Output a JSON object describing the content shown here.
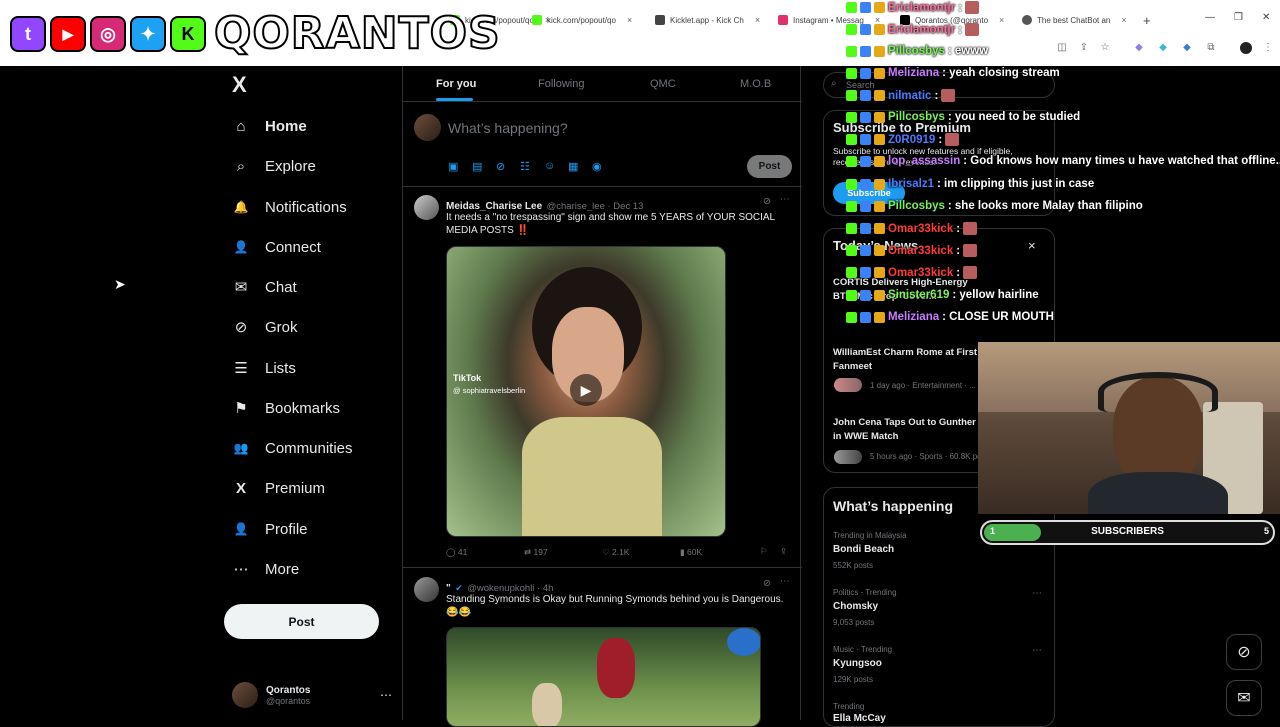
{
  "browser": {
    "tabs": [
      {
        "label": "kick.com/popout/qo",
        "color": "#53fc18"
      },
      {
        "label": "Kicklet.app - Kick Ch",
        "color": "#2a2a2a"
      },
      {
        "label": "Instagram • Messag",
        "color": "#e1306c"
      },
      {
        "label": "Qorantos (@qoranto",
        "color": "#000000"
      },
      {
        "label": "The best ChatBot an",
        "color": "#444444"
      }
    ],
    "new_tab": "+",
    "tab_close": "×"
  },
  "overlay": {
    "brand": "QORANTOS",
    "logos": [
      {
        "name": "twitch",
        "glyph": "t",
        "color": "#9146ff"
      },
      {
        "name": "youtube",
        "glyph": "▶",
        "color": "#ff0000"
      },
      {
        "name": "instagram",
        "glyph": "◎",
        "color": "#d62976"
      },
      {
        "name": "twitter",
        "glyph": "✦",
        "color": "#1da1f2"
      },
      {
        "name": "kick",
        "glyph": "K",
        "color": "#53fc18"
      }
    ]
  },
  "nav": {
    "logo": "X",
    "items": [
      {
        "label": "Home",
        "icon": "⌂"
      },
      {
        "label": "Explore",
        "icon": "⌕"
      },
      {
        "label": "Notifications",
        "icon": "🔔"
      },
      {
        "label": "Connect",
        "icon": "👤"
      },
      {
        "label": "Chat",
        "icon": "✉"
      },
      {
        "label": "Grok",
        "icon": "⊘"
      },
      {
        "label": "Lists",
        "icon": "☰"
      },
      {
        "label": "Bookmarks",
        "icon": "⚑"
      },
      {
        "label": "Communities",
        "icon": "👥"
      },
      {
        "label": "Premium",
        "icon": "X"
      },
      {
        "label": "Profile",
        "icon": "👤"
      },
      {
        "label": "More",
        "icon": "⋯"
      }
    ],
    "post_label": "Post",
    "account": {
      "name": "Qorantos",
      "handle": "@qorantos",
      "more": "⋯"
    }
  },
  "timeline": {
    "tabs": [
      "For you",
      "Following",
      "QMC",
      "M.O.B"
    ],
    "compose_placeholder": "What’s happening?",
    "compose_post": "Post",
    "tweets": [
      {
        "name": "Meidas_Charise Lee",
        "meta": "@charise_lee · Dec 13",
        "text": "It needs a \"no trespassing\" sign and show me 5 YEARS of YOUR SOCIAL MEDIA POSTS ‼️",
        "media_label": "TikTok",
        "media_handle": "@ sophiatravelsberlin",
        "replies": "41",
        "reposts": "197",
        "likes": "2.1K",
        "views": "60K"
      },
      {
        "name": "\"",
        "meta": "@wokenupkohli · 4h",
        "text": "Standing Symonds is Okay but Running Symonds behind you is Dangerous. 😂😂"
      }
    ]
  },
  "right": {
    "search_placeholder": "Search",
    "premium_title": "Subscribe to Premium",
    "premium_text": "Subscribe to unlock new features and if eligible, receive a share of revenue.",
    "premium_button": "Subscribe",
    "news_title": "Today’s News",
    "news_close": "×",
    "news": [
      {
        "title": "CORTIS Delivers High-Energy BTS 'Mic Drop' Cover...",
        "meta": ""
      },
      {
        "title": "WilliamEst Charm Rome at First Fanmeet",
        "meta": "1 day ago · Entertainment · ..."
      },
      {
        "title": "John Cena Taps Out to Gunther in WWE Match",
        "meta": "5 hours ago · Sports · 60.8K posts"
      }
    ],
    "happening_title": "What’s happening",
    "trends": [
      {
        "context": "Trending in Malaysia",
        "name": "Bondi Beach",
        "posts": "552K posts"
      },
      {
        "context": "Politics · Trending",
        "name": "Chomsky",
        "posts": "9,053 posts"
      },
      {
        "context": "Music · Trending",
        "name": "Kyungsoo",
        "posts": "129K posts"
      },
      {
        "context": "Trending",
        "name": "Ella McCay",
        "posts": ""
      }
    ]
  },
  "chat": [
    {
      "user": "Ericlamontjr",
      "color": "#ff6b9a",
      "message": ":",
      "emote": true
    },
    {
      "user": "Ericlamontjr",
      "color": "#ff6b9a",
      "message": ":",
      "emote": true
    },
    {
      "user": "Pillcosbys",
      "color": "#7cf05a",
      "message": ": ewww"
    },
    {
      "user": "Meliziana",
      "color": "#c77dff",
      "message": ": yeah closing stream"
    },
    {
      "user": "nilmatic",
      "color": "#4a7bff",
      "message": ":",
      "emote": true
    },
    {
      "user": "Pillcosbys",
      "color": "#7cf05a",
      "message": ": you need to be studied"
    },
    {
      "user": "Z0R0919",
      "color": "#4a7bff",
      "message": ":",
      "emote": true
    },
    {
      "user": "lop_assassin",
      "color": "#c77dff",
      "message": ": God knows how many times u have watched that offline...."
    },
    {
      "user": "Ibrisalz1",
      "color": "#4a7bff",
      "message": ": im clipping this just in case"
    },
    {
      "user": "Pillcosbys",
      "color": "#7cf05a",
      "message": ": she looks more Malay than filipino"
    },
    {
      "user": "Omar33kick",
      "color": "#ff3b3b",
      "message": ":",
      "emote": true
    },
    {
      "user": "Omar33kick",
      "color": "#ff3b3b",
      "message": ":",
      "emote": true
    },
    {
      "user": "Omar33kick",
      "color": "#ff3b3b",
      "message": ":",
      "emote": true
    },
    {
      "user": "Sinister619",
      "color": "#7cf05a",
      "message": ": yellow hairline"
    },
    {
      "user": "Meliziana",
      "color": "#c77dff",
      "message": ": CLOSE UR MOUTH"
    }
  ],
  "subs": {
    "label": "SUBSCRIBERS",
    "current": "1",
    "goal": "5",
    "progress": 0.2
  },
  "colors": {
    "accent": "#1d9bf0",
    "background": "#000000",
    "text": "#e7e9ea",
    "muted": "#71767b",
    "border": "#2f3336"
  }
}
